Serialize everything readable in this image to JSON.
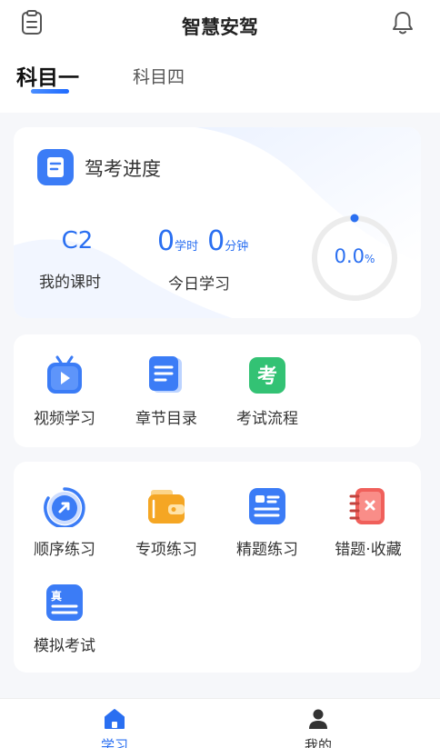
{
  "header": {
    "title": "智慧安驾",
    "left_icon": "clipboard-icon",
    "right_icon": "bell-icon"
  },
  "tabs": [
    {
      "label": "科目一",
      "active": true
    },
    {
      "label": "科目四",
      "active": false
    }
  ],
  "progress": {
    "title": "驾考进度",
    "license_value": "C2",
    "license_label": "我的课时",
    "today_hours": "0",
    "today_hours_unit": "学时",
    "today_minutes": "0",
    "today_minutes_unit": "分钟",
    "today_label": "今日学习",
    "percent_value": "0.0",
    "percent_unit": "%",
    "percent": 0.0
  },
  "quick": [
    {
      "label": "视频学习",
      "icon": "tv-play-icon"
    },
    {
      "label": "章节目录",
      "icon": "document-icon"
    },
    {
      "label": "考试流程",
      "icon": "exam-icon",
      "glyph": "考"
    }
  ],
  "practice": [
    {
      "label": "顺序练习",
      "icon": "sequence-icon"
    },
    {
      "label": "专项练习",
      "icon": "wallet-icon"
    },
    {
      "label": "精题练习",
      "icon": "list-icon"
    },
    {
      "label": "错题·收藏",
      "icon": "wrong-notebook-icon"
    },
    {
      "label": "模拟考试",
      "icon": "mock-exam-icon",
      "glyph": "真"
    }
  ],
  "tabbar": [
    {
      "label": "学习",
      "icon": "home-icon",
      "active": true
    },
    {
      "label": "我的",
      "icon": "user-icon",
      "active": false
    }
  ],
  "colors": {
    "accent": "#2a6ff1",
    "green": "#33c274",
    "orange": "#f5a623",
    "red": "#f0605b"
  }
}
